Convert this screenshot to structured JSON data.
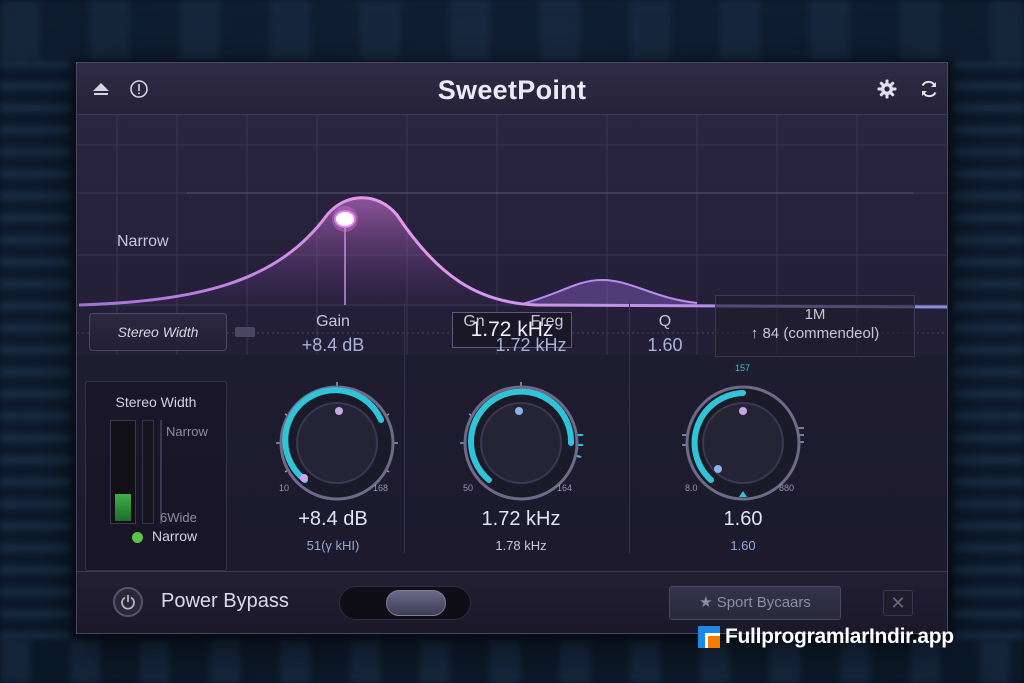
{
  "app": {
    "title": "SweetPoint"
  },
  "titlebar": {
    "left_icons": [
      "up-arrow-icon",
      "info-icon"
    ],
    "right_icons": [
      "gear-icon",
      "refresh-icon"
    ]
  },
  "graph": {
    "band_label": "Narrow",
    "frequency_readout": "1.72 kHz"
  },
  "stereo_button": {
    "label": "Stereo Width"
  },
  "params": {
    "gain": {
      "head": "Gain",
      "value": "+8.4 dB"
    },
    "freq": {
      "head_left": "Gn",
      "head": "Freg",
      "value": "1.72 kHz"
    },
    "q": {
      "head": "Q",
      "value": "1.60"
    },
    "suggest": {
      "title": "1M",
      "value": "84 (commendeol)"
    }
  },
  "meter": {
    "title": "Stereo Width",
    "top_label": "Narrow",
    "bottom_label": "6Wide",
    "status_label": "Narrow",
    "level": 0.28
  },
  "knobs": {
    "gain": {
      "min": "10",
      "max": "168",
      "display": "+8.4 dB",
      "sub": "51(γ kHI)",
      "level": 0.72
    },
    "freq": {
      "min": "50",
      "max": "164",
      "display": "1.72 kHz",
      "sub": "1.78 kHz",
      "level": 0.62
    },
    "q": {
      "min": "8.0",
      "max": "880",
      "top": "157",
      "display": "1.60",
      "sub": "1.60",
      "level": 0.52
    }
  },
  "footer": {
    "bypass_label": "Power Bypass",
    "sport_button": "★ Sport Bycaars",
    "close_symbol": "✕"
  },
  "watermark": {
    "text": "FullprogramlarIndir.app"
  },
  "colors": {
    "accent_teal": "#2fc4d8",
    "accent_pink": "#e07ee6",
    "meter_green": "#3eb04a"
  }
}
